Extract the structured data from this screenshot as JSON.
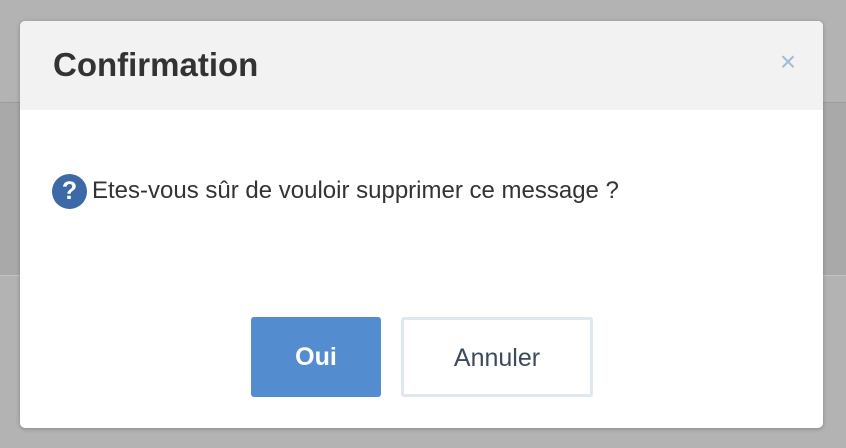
{
  "dialog": {
    "title": "Confirmation",
    "close_icon": "×",
    "question_icon": "?",
    "message": "Etes-vous sûr de vouloir supprimer ce message ?",
    "buttons": {
      "yes_label": "Oui",
      "cancel_label": "Annuler"
    }
  },
  "colors": {
    "primary": "#548dcf",
    "icon": "#3d6aa6",
    "overlay": "#b3b3b3"
  }
}
